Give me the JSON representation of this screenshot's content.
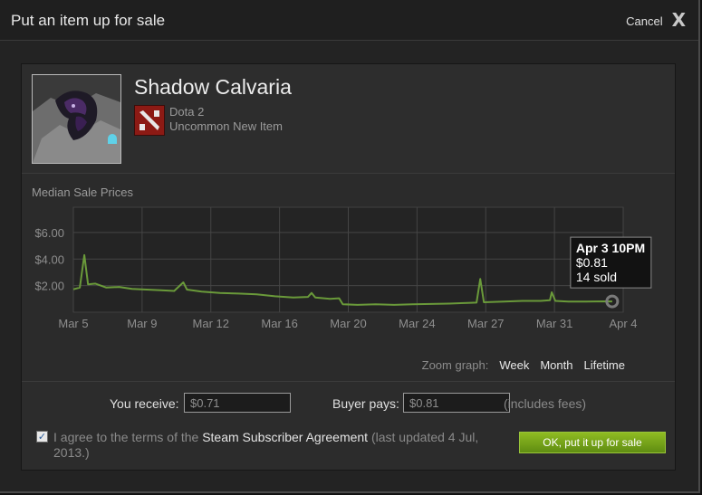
{
  "dialog": {
    "title": "Put an item up for sale",
    "cancel_label": "Cancel",
    "close_glyph": "X"
  },
  "item": {
    "name": "Shadow Calvaria",
    "game": "Dota 2",
    "type": "Uncommon New Item"
  },
  "chart": {
    "title": "Median Sale Prices",
    "tooltip": {
      "date": "Apr 3 10PM",
      "price": "$0.81",
      "sold": "14 sold"
    },
    "zoom_label": "Zoom graph:",
    "zoom_options": [
      "Week",
      "Month",
      "Lifetime"
    ]
  },
  "chart_data": {
    "type": "line",
    "title": "Median Sale Prices",
    "xlabel": "",
    "ylabel": "",
    "x_tick_labels": [
      "Mar 5",
      "Mar 9",
      "Mar 12",
      "Mar 16",
      "Mar 20",
      "Mar 24",
      "Mar 27",
      "Mar 31",
      "Apr 4"
    ],
    "y_tick_labels": [
      "$2.00",
      "$4.00",
      "$6.00"
    ],
    "y_ticks": [
      2,
      4,
      6
    ],
    "ylim": [
      0,
      7.9
    ],
    "x_days_range": [
      0,
      30
    ],
    "grid": true,
    "line_color": "#6a9a3a",
    "points": [
      [
        0,
        1.72
      ],
      [
        0.35,
        1.85
      ],
      [
        0.6,
        4.3
      ],
      [
        0.8,
        2.1
      ],
      [
        1.2,
        2.15
      ],
      [
        1.8,
        1.85
      ],
      [
        2.5,
        1.9
      ],
      [
        3.2,
        1.75
      ],
      [
        4.0,
        1.7
      ],
      [
        4.8,
        1.65
      ],
      [
        5.5,
        1.6
      ],
      [
        6.0,
        2.25
      ],
      [
        6.2,
        1.7
      ],
      [
        7.0,
        1.55
      ],
      [
        8.0,
        1.45
      ],
      [
        9.0,
        1.4
      ],
      [
        10.0,
        1.35
      ],
      [
        11.0,
        1.2
      ],
      [
        12.0,
        1.1
      ],
      [
        12.8,
        1.15
      ],
      [
        13.0,
        1.45
      ],
      [
        13.2,
        1.1
      ],
      [
        14.0,
        1.0
      ],
      [
        14.5,
        1.05
      ],
      [
        14.7,
        0.6
      ],
      [
        15.5,
        0.55
      ],
      [
        16.5,
        0.6
      ],
      [
        17.5,
        0.55
      ],
      [
        18.5,
        0.6
      ],
      [
        19.5,
        0.62
      ],
      [
        20.5,
        0.65
      ],
      [
        21.5,
        0.7
      ],
      [
        22.0,
        0.72
      ],
      [
        22.2,
        2.5
      ],
      [
        22.4,
        0.75
      ],
      [
        23.5,
        0.8
      ],
      [
        24.5,
        0.85
      ],
      [
        25.5,
        0.85
      ],
      [
        26.0,
        0.9
      ],
      [
        26.1,
        1.5
      ],
      [
        26.3,
        0.85
      ],
      [
        27.0,
        0.8
      ],
      [
        28.0,
        0.8
      ],
      [
        29.0,
        0.82
      ],
      [
        29.4,
        0.81
      ]
    ]
  },
  "pricing": {
    "receive_label": "You receive:",
    "receive_value": "$0.71",
    "buyer_label": "Buyer pays:",
    "buyer_value": "$0.81",
    "fees_note": "(includes fees)"
  },
  "agreement": {
    "checked": true,
    "check_glyph": "✓",
    "text_before": "I agree to the terms of the",
    "link_text": "Steam Subscriber Agreement",
    "text_after": "(last updated 4 Jul, 2013.)"
  },
  "ok_button_label": "OK, put it up for sale",
  "colors": {
    "accent_green": "#7aa81a",
    "dota_red": "#8c1a14"
  }
}
